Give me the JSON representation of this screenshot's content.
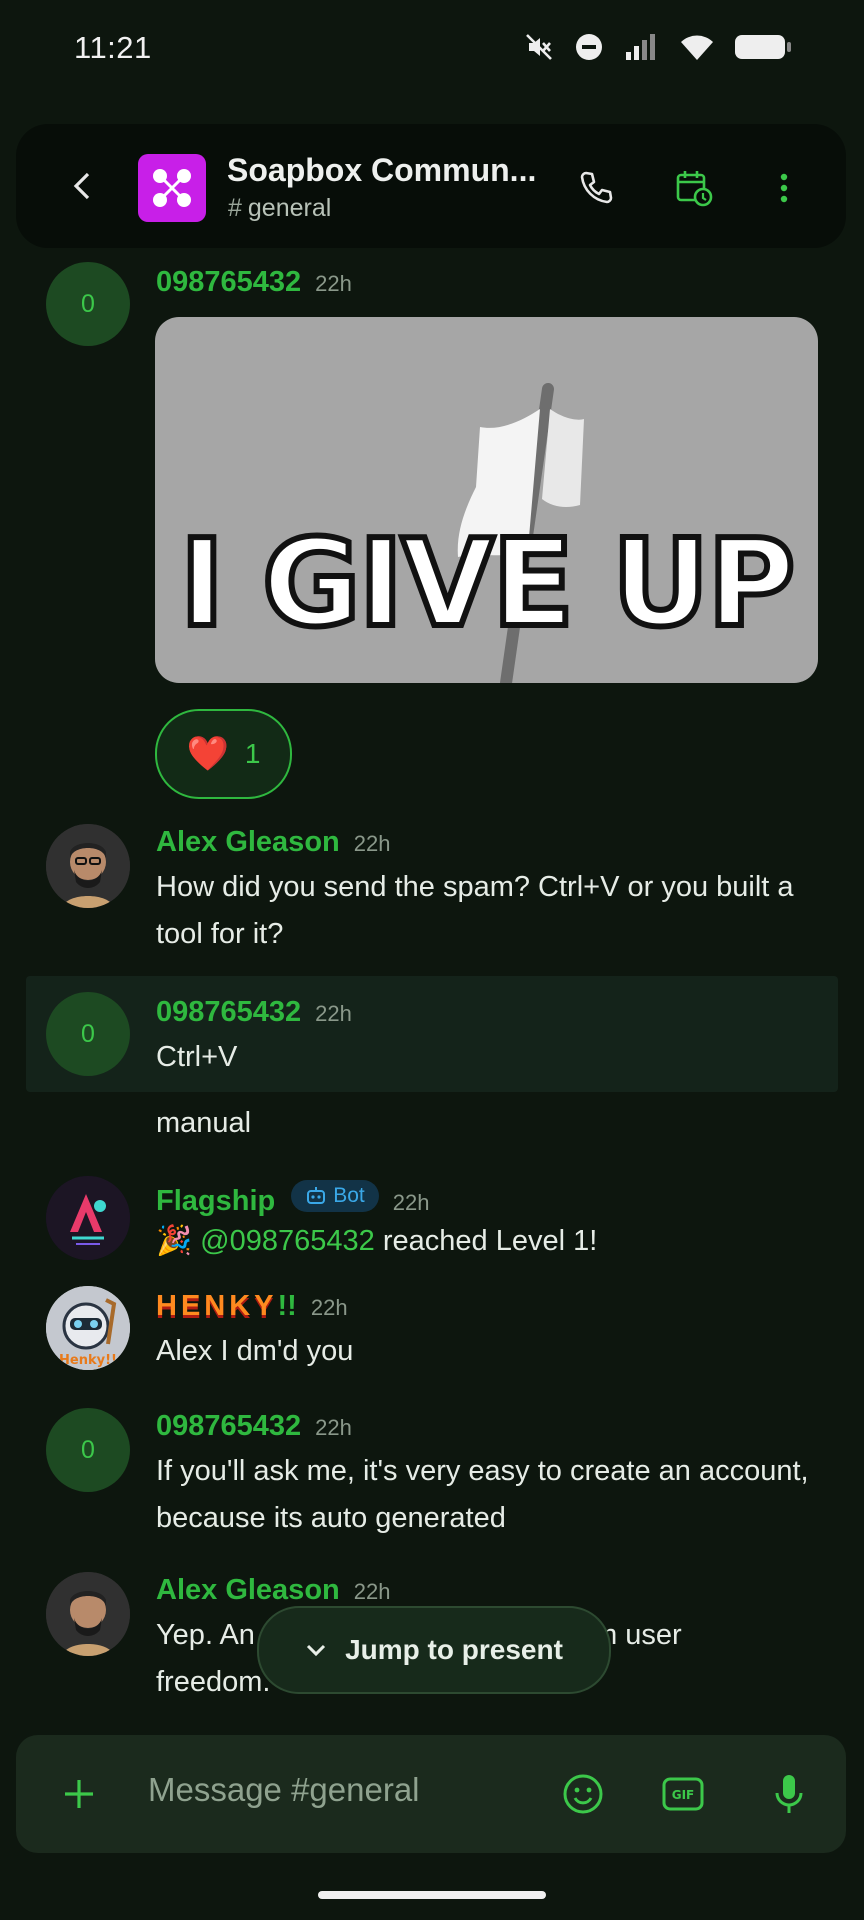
{
  "status_bar": {
    "time": "11:21"
  },
  "header": {
    "title": "Soapbox Commun...",
    "channel_hash": "#",
    "channel": "general"
  },
  "messages": [
    {
      "avatar": "0",
      "author": "098765432",
      "time": "22h",
      "gif_text": "I GIVE UP",
      "reaction_emoji": "❤️",
      "reaction_count": "1"
    },
    {
      "author": "Alex Gleason",
      "time": "22h",
      "text": "How did you send the spam? Ctrl+V or you built a tool for it?"
    },
    {
      "avatar": "0",
      "author": "098765432",
      "time": "22h",
      "text": "Ctrl+V",
      "followup": "manual"
    },
    {
      "author": "Flagship",
      "badge": "Bot",
      "time": "22h",
      "emoji": "🎉",
      "mention": "@098765432",
      "text": " reached Level 1!",
      "avatar_letter": "A"
    },
    {
      "author": "HENKY",
      "author_suffix": "!!",
      "time": "22h",
      "text": "Alex I dm'd you",
      "avatar_text": "Henky!!"
    },
    {
      "avatar": "0",
      "author": "098765432",
      "time": "22h",
      "text": "If you'll ask me, it's very easy to create an account, because its auto generated"
    },
    {
      "author": "Alex Gleason",
      "time": "22h",
      "text_before": "Yep. An",
      "text_after": "um user",
      "text_line2": "freedom."
    }
  ],
  "jump_to_present": "Jump to present",
  "composer": {
    "placeholder": "Message #general"
  },
  "colors": {
    "accent": "#2fb83f",
    "background": "#0d160e",
    "server_icon": "#c81fe8",
    "bot_badge": "#3aa8e8"
  }
}
